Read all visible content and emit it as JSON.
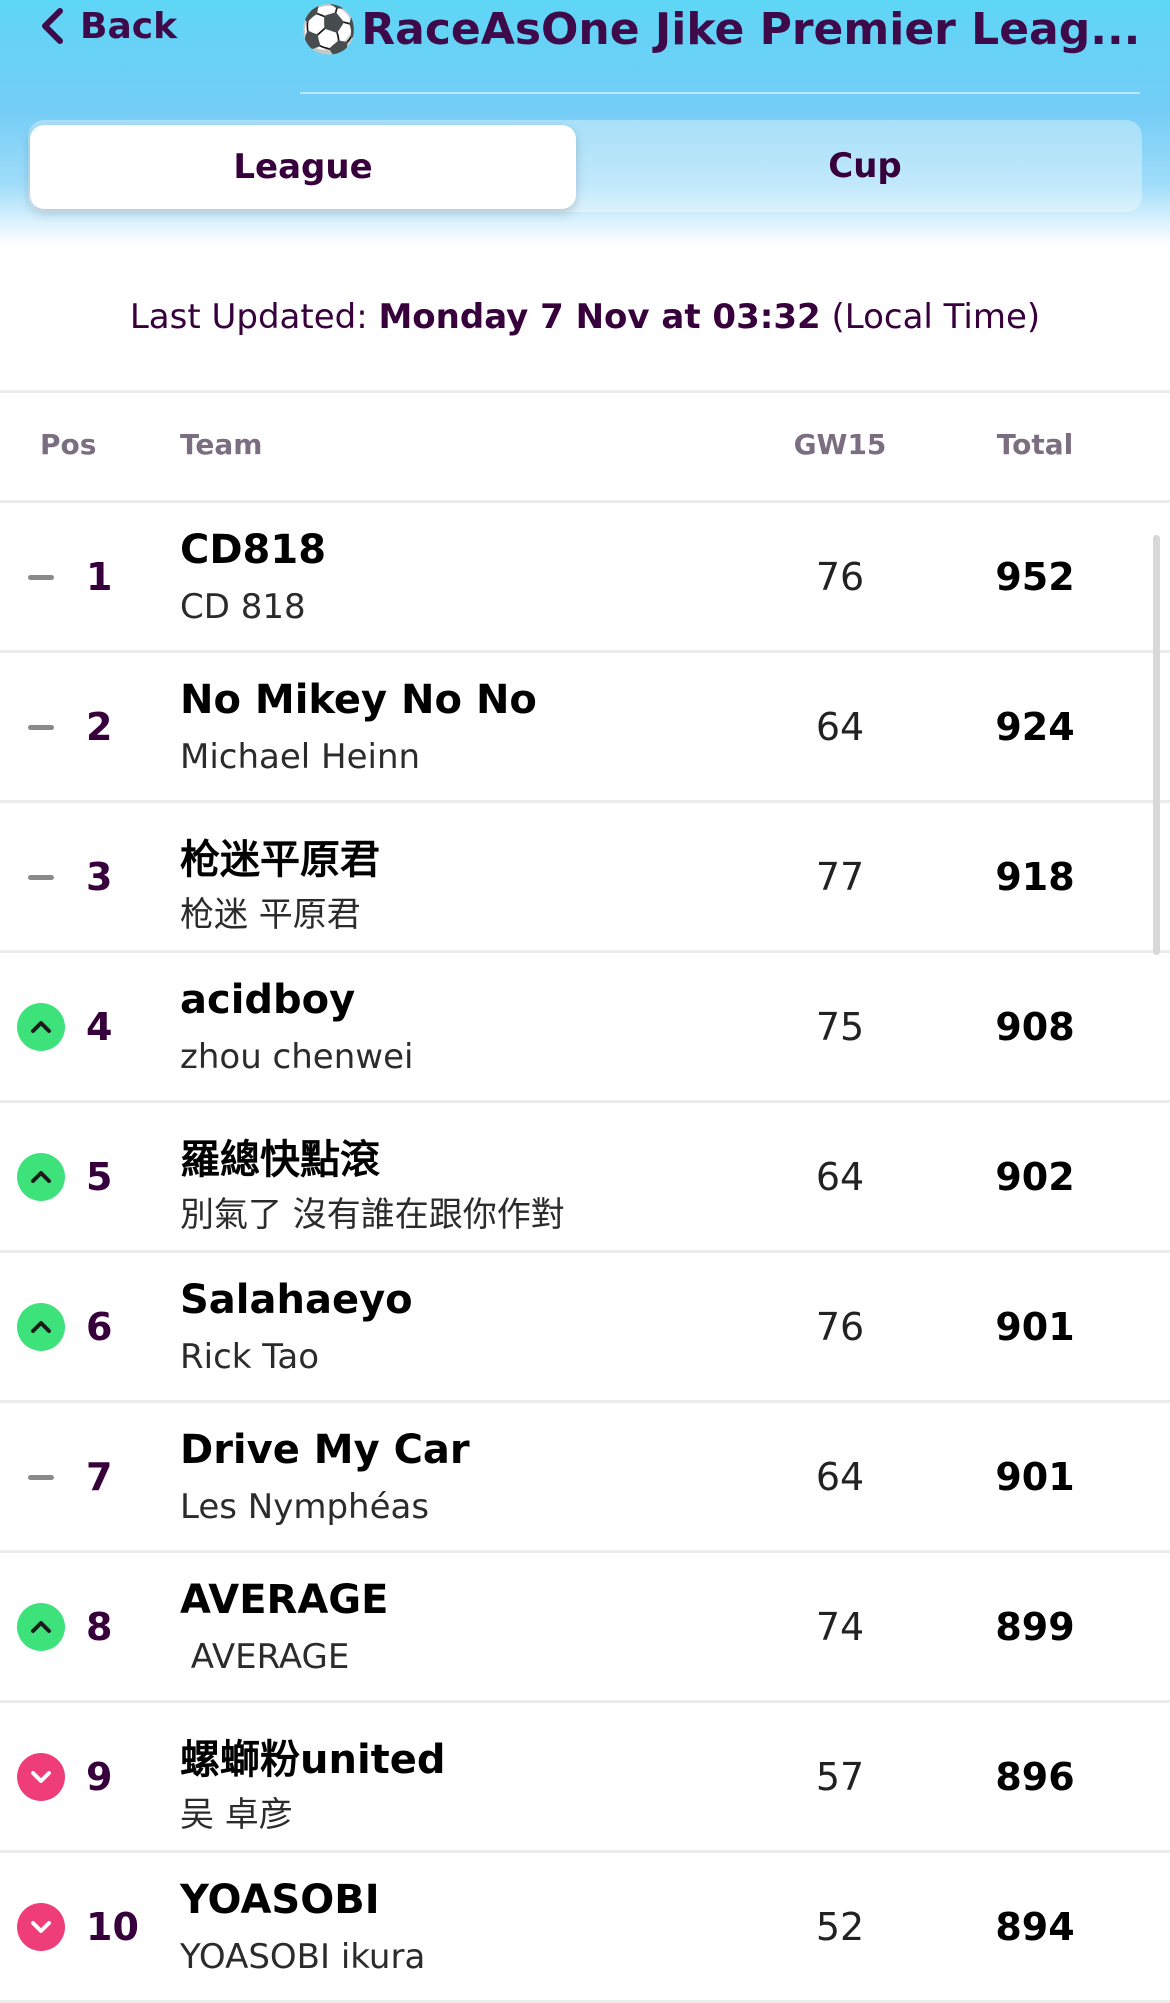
{
  "topbar": {
    "back_label": "Back",
    "title_icon": "⚽",
    "title": "RaceAsOne Jike Premier Leag..."
  },
  "tabs": [
    {
      "label": "League",
      "active": true
    },
    {
      "label": "Cup",
      "active": false
    }
  ],
  "updated": {
    "prefix": "Last Updated: ",
    "datetime": "Monday 7 Nov at 03:32",
    "suffix": " (Local Time)"
  },
  "table": {
    "headers": {
      "pos": "Pos",
      "team": "Team",
      "gw": "GW15",
      "total": "Total"
    },
    "rows": [
      {
        "movement": "same",
        "pos": "1",
        "team": "CD818",
        "manager": "CD 818",
        "gw": "76",
        "total": "952"
      },
      {
        "movement": "same",
        "pos": "2",
        "team": "No Mikey No No",
        "manager": "Michael Heinn",
        "gw": "64",
        "total": "924"
      },
      {
        "movement": "same",
        "pos": "3",
        "team": "枪迷平原君",
        "manager": "枪迷 平原君",
        "gw": "77",
        "total": "918"
      },
      {
        "movement": "up",
        "pos": "4",
        "team": "acidboy",
        "manager": "zhou chenwei",
        "gw": "75",
        "total": "908"
      },
      {
        "movement": "up",
        "pos": "5",
        "team": "羅總快點滾",
        "manager": "別氣了 沒有誰在跟你作對",
        "gw": "64",
        "total": "902"
      },
      {
        "movement": "up",
        "pos": "6",
        "team": "Salahaeyo",
        "manager": "Rick Tao",
        "gw": "76",
        "total": "901"
      },
      {
        "movement": "same",
        "pos": "7",
        "team": "Drive My Car",
        "manager": "Les Nymphéas",
        "gw": "64",
        "total": "901"
      },
      {
        "movement": "up",
        "pos": "8",
        "team": "AVERAGE",
        "manager": " AVERAGE",
        "gw": "74",
        "total": "899"
      },
      {
        "movement": "down",
        "pos": "9",
        "team": "螺螄粉united",
        "manager": "吴 卓彦",
        "gw": "57",
        "total": "896"
      },
      {
        "movement": "down",
        "pos": "10",
        "team": "YOASOBI",
        "manager": "YOASOBI ikura",
        "gw": "52",
        "total": "894"
      }
    ]
  },
  "colors": {
    "primary": "#37003c",
    "up": "#3de27a",
    "down": "#ee3d78",
    "header_gradient_top": "#5ed6f5"
  }
}
